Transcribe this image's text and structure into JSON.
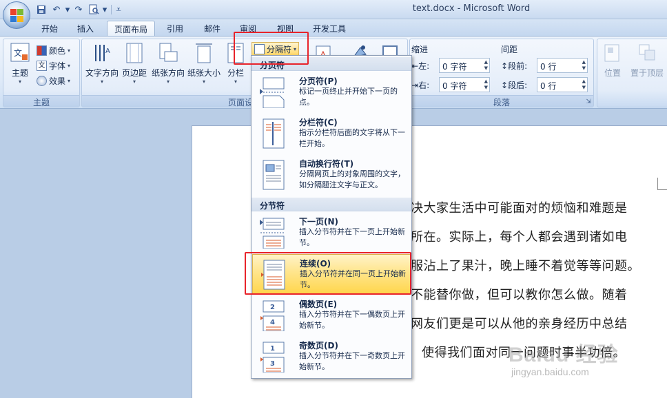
{
  "window": {
    "title": "text.docx - Microsoft Word"
  },
  "tabs": [
    "开始",
    "插入",
    "页面布局",
    "引用",
    "邮件",
    "审阅",
    "视图",
    "开发工具"
  ],
  "active_tab": "页面布局",
  "ribbon": {
    "theme_group": {
      "label": "主题",
      "theme_btn": "主题",
      "colors": "颜色",
      "fonts": "字体",
      "effects": "效果"
    },
    "page_setup": {
      "label": "页面设置",
      "text_direction": "文字方向",
      "margins": "页边距",
      "orientation": "纸张方向",
      "size": "纸张大小",
      "columns": "分栏"
    },
    "breaks_button": "分隔符",
    "paragraph": {
      "label": "段落",
      "indent_label": "缩进",
      "spacing_label": "间距",
      "left": "左:",
      "right": "右:",
      "before": "段前:",
      "after": "段后:",
      "indent_left_value": "0 字符",
      "indent_right_value": "0 字符",
      "before_value": "0 行",
      "after_value": "0 行"
    },
    "arrange": {
      "position": "位置",
      "bring_front": "置于顶层"
    }
  },
  "menu": {
    "page_breaks_header": "分页符",
    "section_breaks_header": "分节符",
    "items": [
      {
        "title": "分页符(P)",
        "desc": "标记一页终止并开始下一页的点。"
      },
      {
        "title": "分栏符(C)",
        "desc": "指示分栏符后面的文字将从下一栏开始。"
      },
      {
        "title": "自动换行符(T)",
        "desc": "分隔网页上的对象周围的文字，如分隔题注文字与正文。"
      },
      {
        "title": "下一页(N)",
        "desc": "插入分节符并在下一页上开始新节。"
      },
      {
        "title": "连续(O)",
        "desc": "插入分节符并在同一页上开始新节。"
      },
      {
        "title": "偶数页(E)",
        "desc": "插入分节符并在下一偶数页上开始新节。"
      },
      {
        "title": "奇数页(D)",
        "desc": "插入分节符并在下一奇数页上开始新节。"
      }
    ],
    "selected_index": 4
  },
  "document": {
    "lines": [
      "决大家生活中可能面对的烦恼和难题是",
      "所在。实际上，每个人都会遇到诸如电",
      "服沾上了果汁，晚上睡不着觉等等问题。",
      "不能替你做，但可以教你怎么做。随着",
      "网友们更是可以从他的亲身经历中总结",
      "使得我们面对同一问题时事半功倍。"
    ]
  },
  "watermark": {
    "brand": "Baidu 经验",
    "url": "jingyan.baidu.com"
  },
  "colors": {
    "highlight": "#e8232a",
    "ribbon": "#dfeaf8",
    "selected_item": "#ffd64d"
  }
}
